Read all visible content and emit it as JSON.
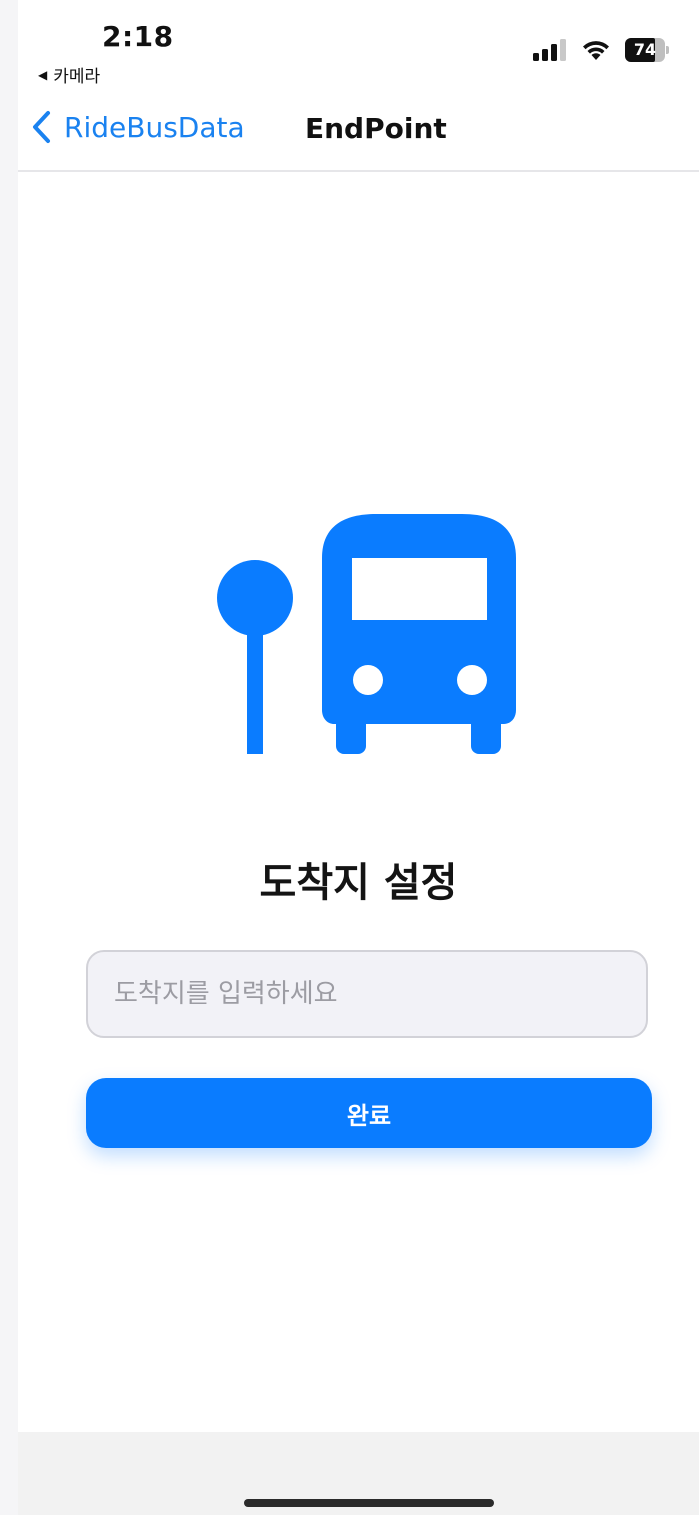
{
  "status_bar": {
    "time": "2:18",
    "back_app": "카메라",
    "back_glyph": "◀",
    "battery": "74"
  },
  "nav": {
    "back_label": "RideBusData",
    "title": "EndPoint"
  },
  "main": {
    "heading": "도착지 설정",
    "input_placeholder": "도착지를 입력하세요",
    "input_value": "",
    "done_label": "완료"
  },
  "colors": {
    "accent": "#0a7cff",
    "nav_tint": "#1a82f0",
    "input_bg": "#f2f2f7"
  },
  "icons": {
    "illustration": "bus-stop-icon",
    "back": "chevron-left-icon"
  }
}
